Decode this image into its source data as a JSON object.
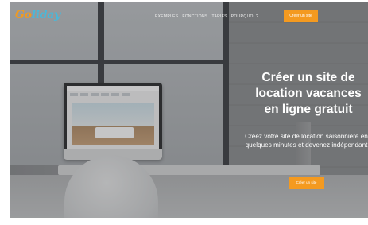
{
  "header": {
    "logo_go": "Go",
    "logo_rest": "liday",
    "nav_items": [
      "EXEMPLES",
      "FONCTIONS",
      "TARIFS",
      "POURQUOI ?"
    ],
    "cta_label": "Créer un site"
  },
  "hero": {
    "title": "Créer un site de location vacances en ligne gratuit",
    "subtitle": "Créez votre site de location saisonnière en quelques minutes et devenez indépendant",
    "cta_label": "Créer un site"
  },
  "colors": {
    "brand_blue": "#4bb7d8",
    "brand_orange": "#f19a1f",
    "cta_orange": "#f49a20"
  }
}
